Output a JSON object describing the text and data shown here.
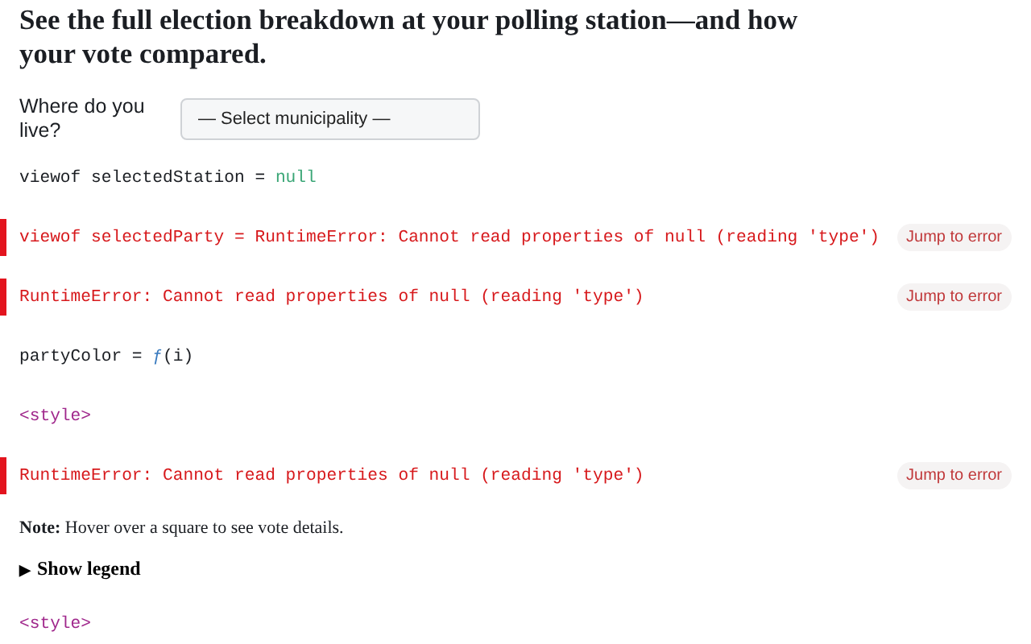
{
  "heading": "See the full election breakdown at your polling station—and how your vote compared.",
  "cells": [
    {
      "kind": "select",
      "label": "Where do you live?",
      "value": "— Select municipality —"
    },
    {
      "kind": "code",
      "parts": [
        {
          "text": "viewof selectedStation = ",
          "kind": "plain"
        },
        {
          "text": "null",
          "kind": "null"
        }
      ]
    },
    {
      "kind": "error",
      "text": "viewof selectedParty = RuntimeError: Cannot read properties of null (reading 'type')",
      "button": "Jump to error"
    },
    {
      "kind": "error",
      "text": "RuntimeError: Cannot read properties of null (reading 'type')",
      "button": "Jump to error"
    },
    {
      "kind": "code",
      "parts": [
        {
          "text": "partyColor = ",
          "kind": "plain"
        },
        {
          "text": "ƒ",
          "kind": "fn"
        },
        {
          "text": "(i)",
          "kind": "plain"
        }
      ]
    },
    {
      "kind": "code",
      "parts": [
        {
          "text": "<style>",
          "kind": "tag"
        }
      ]
    },
    {
      "kind": "error",
      "text": "RuntimeError: Cannot read properties of null (reading 'type')",
      "button": "Jump to error"
    },
    {
      "kind": "note",
      "text": "**Note:** Hover over a square to see vote details."
    },
    {
      "kind": "details",
      "marker": "▶",
      "text": "Show legend",
      "expanded": false
    },
    {
      "kind": "code",
      "parts": [
        {
          "text": "<style>",
          "kind": "tag"
        }
      ]
    }
  ]
}
